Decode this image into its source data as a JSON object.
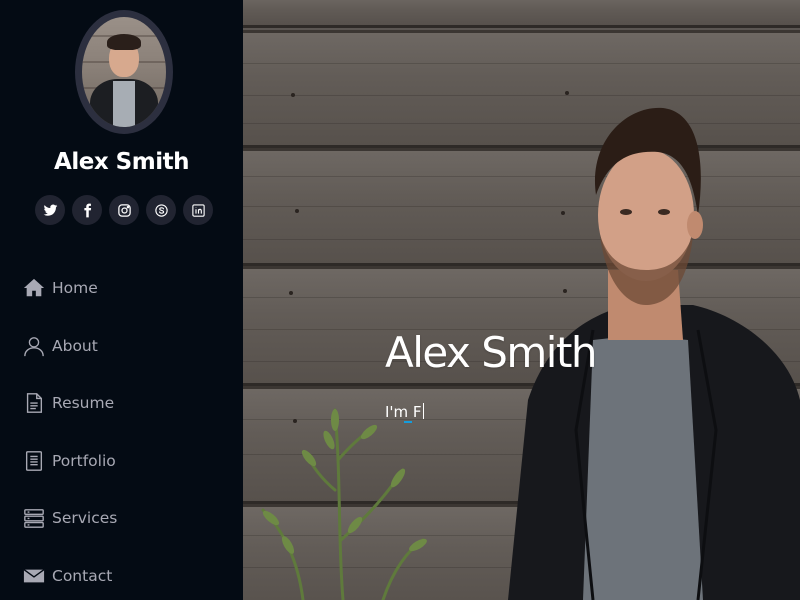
{
  "profile": {
    "name": "Alex Smith"
  },
  "social": [
    {
      "name": "twitter",
      "icon": "twitter-icon"
    },
    {
      "name": "facebook",
      "icon": "facebook-icon"
    },
    {
      "name": "instagram",
      "icon": "instagram-icon"
    },
    {
      "name": "skype",
      "icon": "skype-icon"
    },
    {
      "name": "linkedin",
      "icon": "linkedin-icon"
    }
  ],
  "nav": {
    "items": [
      {
        "label": "Home",
        "icon": "home-icon"
      },
      {
        "label": "About",
        "icon": "user-icon"
      },
      {
        "label": "Resume",
        "icon": "document-icon"
      },
      {
        "label": "Portfolio",
        "icon": "book-icon"
      },
      {
        "label": "Services",
        "icon": "server-icon"
      },
      {
        "label": "Contact",
        "icon": "envelope-icon"
      }
    ]
  },
  "hero": {
    "title": "Alex Smith",
    "subtitle": "I'm F"
  },
  "colors": {
    "sidebar_bg": "#040b14",
    "nav_text": "#a8a9b4",
    "accent": "#149ddd",
    "social_bg": "#212431"
  }
}
